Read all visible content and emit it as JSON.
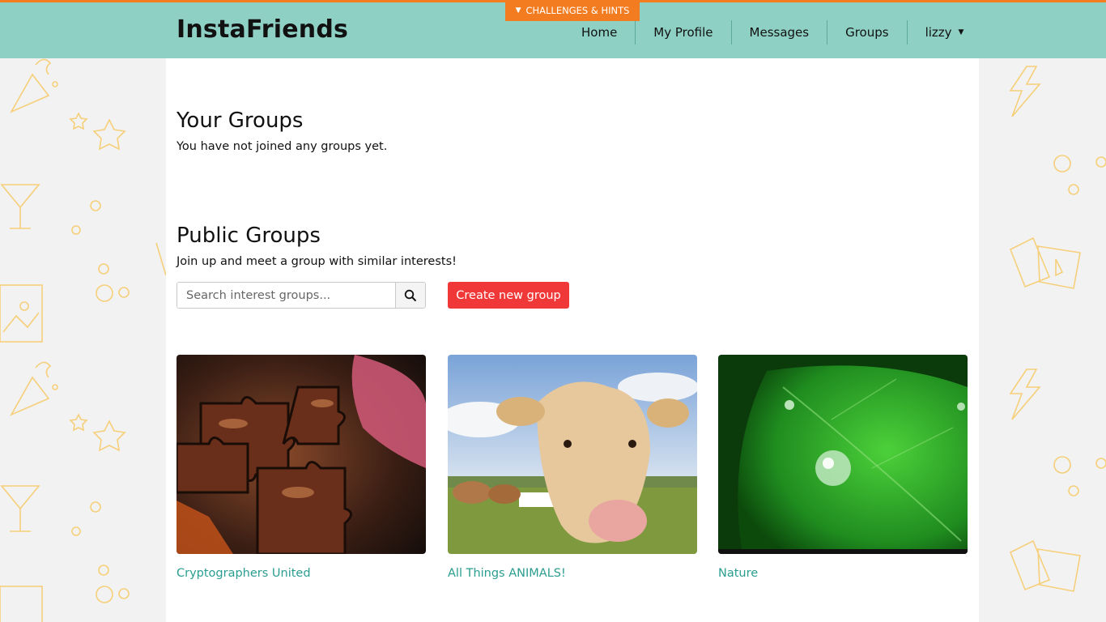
{
  "header": {
    "brand": "InstaFriends",
    "hints_label": "CHALLENGES & HINTS",
    "nav": [
      {
        "label": "Home"
      },
      {
        "label": "My Profile"
      },
      {
        "label": "Messages"
      },
      {
        "label": "Groups"
      },
      {
        "label": "lizzy",
        "dropdown": true
      }
    ]
  },
  "your_groups": {
    "title": "Your Groups",
    "empty_text": "You have not joined any groups yet."
  },
  "public_groups": {
    "title": "Public Groups",
    "subtitle": "Join up and meet a group with similar interests!",
    "search_placeholder": "Search interest groups...",
    "create_label": "Create new group",
    "groups": [
      {
        "name": "Cryptographers United",
        "image": "puzzle-pieces-photo"
      },
      {
        "name": "All Things ANIMALS!",
        "image": "cow-photo"
      },
      {
        "name": "Nature",
        "image": "leaf-droplet-photo"
      }
    ]
  },
  "colors": {
    "navbar": "#8fd0c5",
    "accent_orange": "#f47c20",
    "create_button": "#f13838",
    "link": "#2a9d8f"
  }
}
